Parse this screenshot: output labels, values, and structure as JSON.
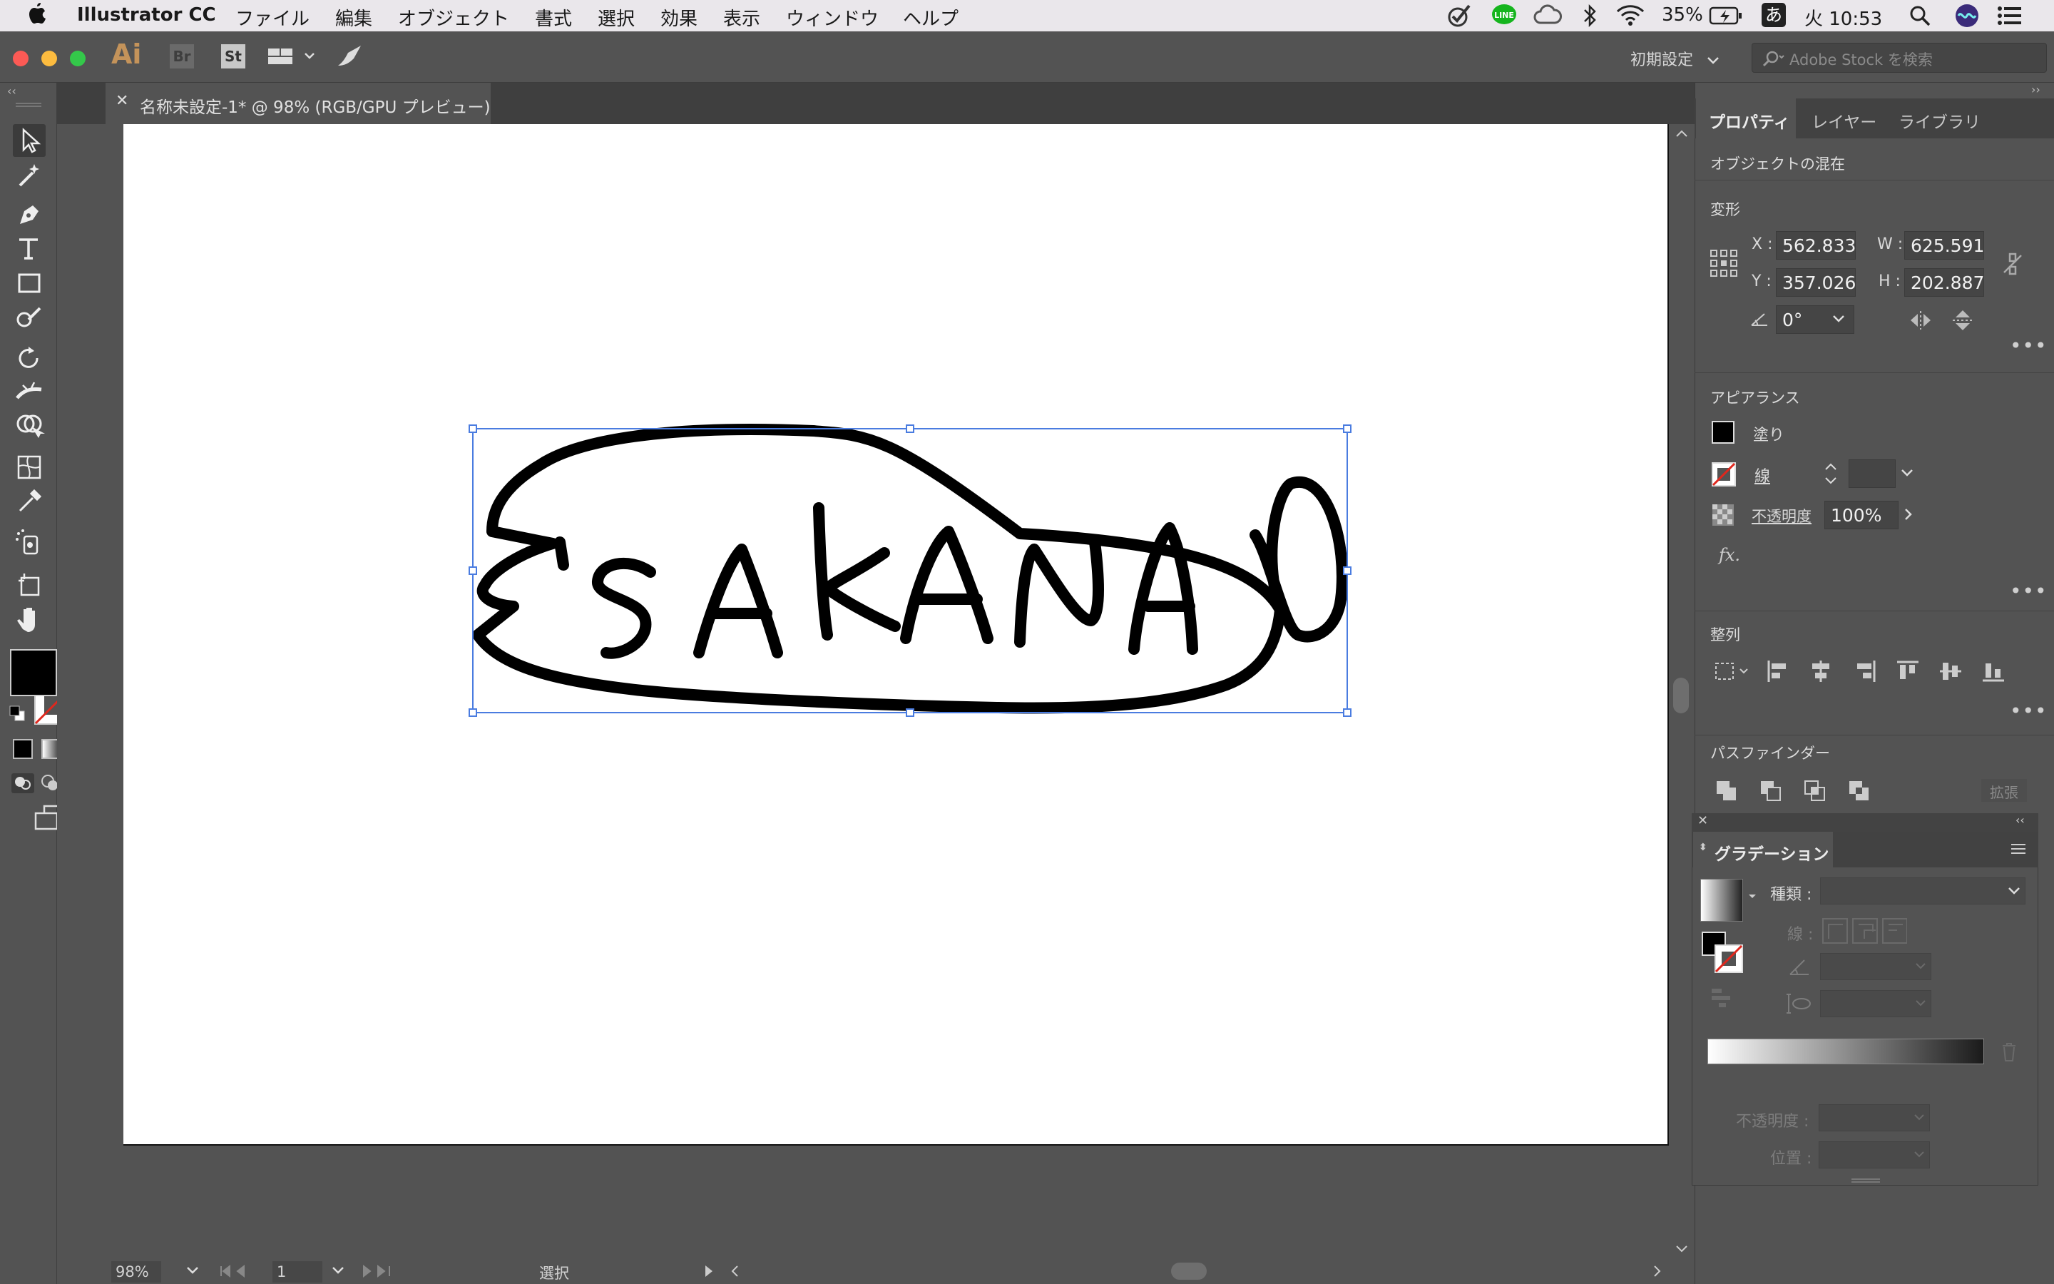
{
  "menubar": {
    "app_name": "Illustrator CC",
    "items": [
      "ファイル",
      "編集",
      "オブジェクト",
      "書式",
      "選択",
      "効果",
      "表示",
      "ウィンドウ",
      "ヘルプ"
    ],
    "battery": "35%",
    "ime": "あ",
    "clock": "火 10:53"
  },
  "appbar": {
    "logo": "Ai",
    "bridge": "Br",
    "stock_icon": "St",
    "workspace": "初期設定",
    "stock_search_placeholder": "Adobe Stock を検索"
  },
  "document": {
    "tab_title": "名称未設定-1* @ 98% (RGB/GPU プレビュー)",
    "artwork_text": "SAKANA"
  },
  "statusbar": {
    "zoom": "98%",
    "page": "1",
    "tool_status": "選択"
  },
  "properties_panel": {
    "tabs": [
      "プロパティ",
      "レイヤー",
      "ライブラリ"
    ],
    "active_tab": "プロパティ",
    "object_type": "オブジェクトの混在",
    "transform": {
      "title": "変形",
      "x_label": "X :",
      "x": "562.833",
      "y_label": "Y :",
      "y": "357.026",
      "w_label": "W :",
      "w": "625.591",
      "h_label": "H :",
      "h": "202.887",
      "angle": "0°"
    },
    "appearance": {
      "title": "アピアランス",
      "fill_label": "塗り",
      "stroke_label": "線",
      "opacity_label": "不透明度",
      "opacity": "100%",
      "fx": "fx."
    },
    "align": {
      "title": "整列"
    },
    "pathfinder": {
      "title": "パスファインダー",
      "expand_label": "拡張"
    }
  },
  "gradient_panel": {
    "title": "グラデーション",
    "type_label": "種類 :",
    "stroke_label": "線 :",
    "opacity_label": "不透明度 :",
    "location_label": "位置 :"
  },
  "colors": {
    "accent_selection": "#4a7ce0",
    "fill": "#000000",
    "stroke_none": "#e0271d"
  }
}
